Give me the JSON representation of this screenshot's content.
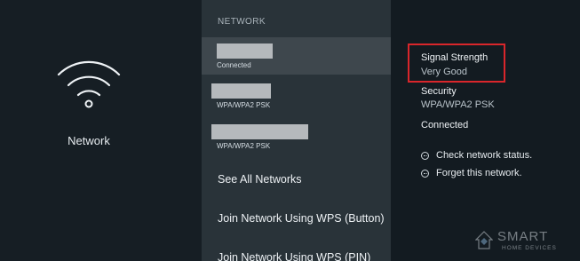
{
  "left": {
    "icon": "wifi-icon",
    "label": "Network"
  },
  "middle": {
    "section_header": "NETWORK",
    "networks": [
      {
        "name": "",
        "subtitle": "Connected",
        "selected": true
      },
      {
        "name": "",
        "subtitle": "WPA/WPA2 PSK",
        "selected": false
      },
      {
        "name": "",
        "subtitle": "WPA/WPA2 PSK",
        "selected": false
      }
    ],
    "menu": [
      {
        "label": "See All Networks"
      },
      {
        "label": "Join Network Using WPS (Button)"
      },
      {
        "label": "Join Network Using WPS (PIN)"
      }
    ]
  },
  "details": {
    "signal_label": "Signal Strength",
    "signal_value": "Very Good",
    "security_label": "Security",
    "security_value": "WPA/WPA2 PSK",
    "status": "Connected",
    "actions": [
      {
        "label": "Check network status.",
        "icon": "menu-button-icon"
      },
      {
        "label": "Forget this network.",
        "icon": "menu-button-icon"
      }
    ]
  },
  "watermark": {
    "title": "SMART",
    "subtitle": "HOME DEVICES"
  },
  "colors": {
    "background": "#131b21",
    "list_background": "#293339",
    "selected_row": "#3e474d",
    "highlight": "#d9262b"
  }
}
